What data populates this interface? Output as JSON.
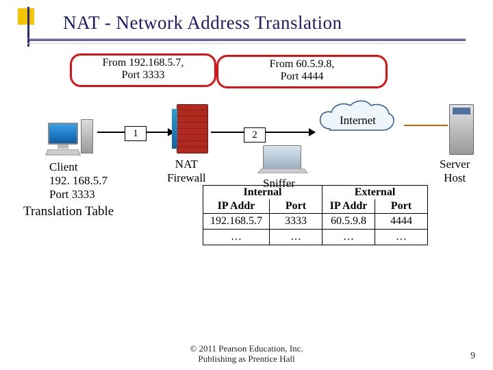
{
  "title": "NAT - Network Address Translation",
  "packet_left": {
    "line1": "From 192.168.5.7,",
    "line2": "Port 3333"
  },
  "packet_right": {
    "line1": "From 60.5.9.8,",
    "line2": "Port 4444"
  },
  "steps": {
    "s1": "1",
    "s2": "2"
  },
  "client": {
    "label": "Client",
    "ip": "192. 168.5.7",
    "port": "Port 3333"
  },
  "firewall_label_l1": "NAT",
  "firewall_label_l2": "Firewall",
  "sniffer_label": "Sniffer",
  "cloud_label": "Internet",
  "server_label_l1": "Server",
  "server_label_l2": "Host",
  "translation_label": "Translation Table",
  "table": {
    "internal_hdr": "Internal",
    "external_hdr": "External",
    "ip_hdr": "IP Addr",
    "port_hdr": "Port",
    "rows": [
      {
        "i_ip": "192.168.5.7",
        "i_port": "3333",
        "e_ip": "60.5.9.8",
        "e_port": "4444"
      },
      {
        "i_ip": "…",
        "i_port": "…",
        "e_ip": "…",
        "e_port": "…"
      }
    ]
  },
  "copyright_l1": "© 2011 Pearson Education, Inc.",
  "copyright_l2": "Publishing as Prentice Hall",
  "page_number": "9"
}
